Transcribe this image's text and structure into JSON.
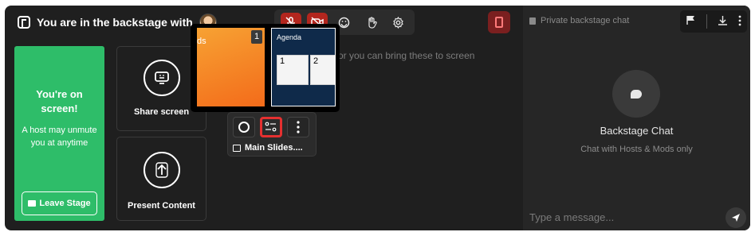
{
  "header": {
    "title": "You are in the backstage with"
  },
  "toolbar": {
    "mic_icon": "mic-off-icon",
    "camera_icon": "camera-off-icon",
    "emoji_icon": "emoji-icon",
    "hand_icon": "raise-hand-icon",
    "settings_icon": "settings-icon",
    "danger_color": "#b3261e"
  },
  "stage_status": {
    "heading": "You're on screen!",
    "subtext": "A host may unmute you at anytime",
    "leave_label": "Leave Stage",
    "color": "#2ebd69"
  },
  "actions": {
    "share_label": "Share screen",
    "present_label": "Present Content"
  },
  "hint_text": "or you can bring these to screen",
  "slide_popup": {
    "thumb1_text": "ds",
    "thumb1_number": "1",
    "thumb2_title": "Agenda",
    "thumb2_box1": "1",
    "thumb2_box2": "2"
  },
  "content_tile": {
    "name": "Main Slides...."
  },
  "chat": {
    "header": "Private backstage chat",
    "title": "Backstage Chat",
    "subtitle": "Chat with Hosts & Mods only",
    "placeholder": "Type a message..."
  }
}
